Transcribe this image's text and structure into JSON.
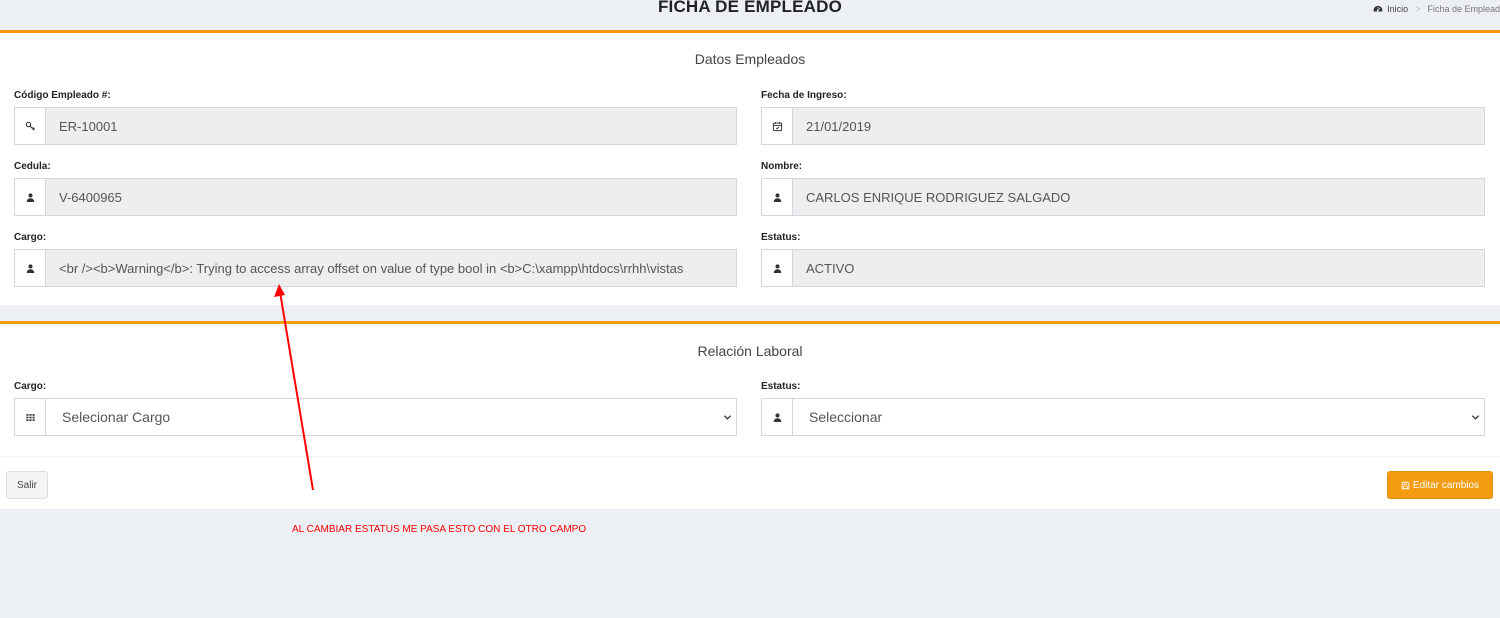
{
  "header": {
    "title": "FICHA DE EMPLEADO",
    "breadcrumb_home": "Inicio",
    "breadcrumb_current": "Ficha de Emplead"
  },
  "datos": {
    "title": "Datos Empleados",
    "codigo": {
      "label": "Código Empleado #:",
      "value": "ER-10001",
      "icon": "key-icon"
    },
    "fecha": {
      "label": "Fecha de Ingreso:",
      "value": "21/01/2019",
      "icon": "calendar-icon"
    },
    "cedula": {
      "label": "Cedula:",
      "value": "V-6400965",
      "icon": "user-icon"
    },
    "nombre": {
      "label": "Nombre:",
      "value": "CARLOS ENRIQUE RODRIGUEZ SALGADO",
      "icon": "user-icon"
    },
    "cargo": {
      "label": "Cargo:",
      "value": "<br /><b>Warning</b>:  Trying to access array offset on value of type bool in <b>C:\\xampp\\htdocs\\rrhh\\vistas",
      "icon": "user-icon"
    },
    "estatus": {
      "label": "Estatus:",
      "value": "ACTIVO",
      "icon": "user-icon"
    }
  },
  "relacion": {
    "title": "Relación Laboral",
    "cargo": {
      "label": "Cargo:",
      "selected": "Selecionar Cargo",
      "icon": "grid-icon"
    },
    "estatus": {
      "label": "Estatus:",
      "selected": "Seleccionar",
      "icon": "user-icon"
    }
  },
  "actions": {
    "salir_label": "Salir",
    "editar_label": "Editar cambios"
  },
  "annotation": {
    "text": "AL CAMBIAR ESTATUS ME PASA ESTO CON EL OTRO CAMPO",
    "color": "#ff0000"
  },
  "colors": {
    "accent": "#f39c12",
    "background": "#ecf0f5"
  }
}
